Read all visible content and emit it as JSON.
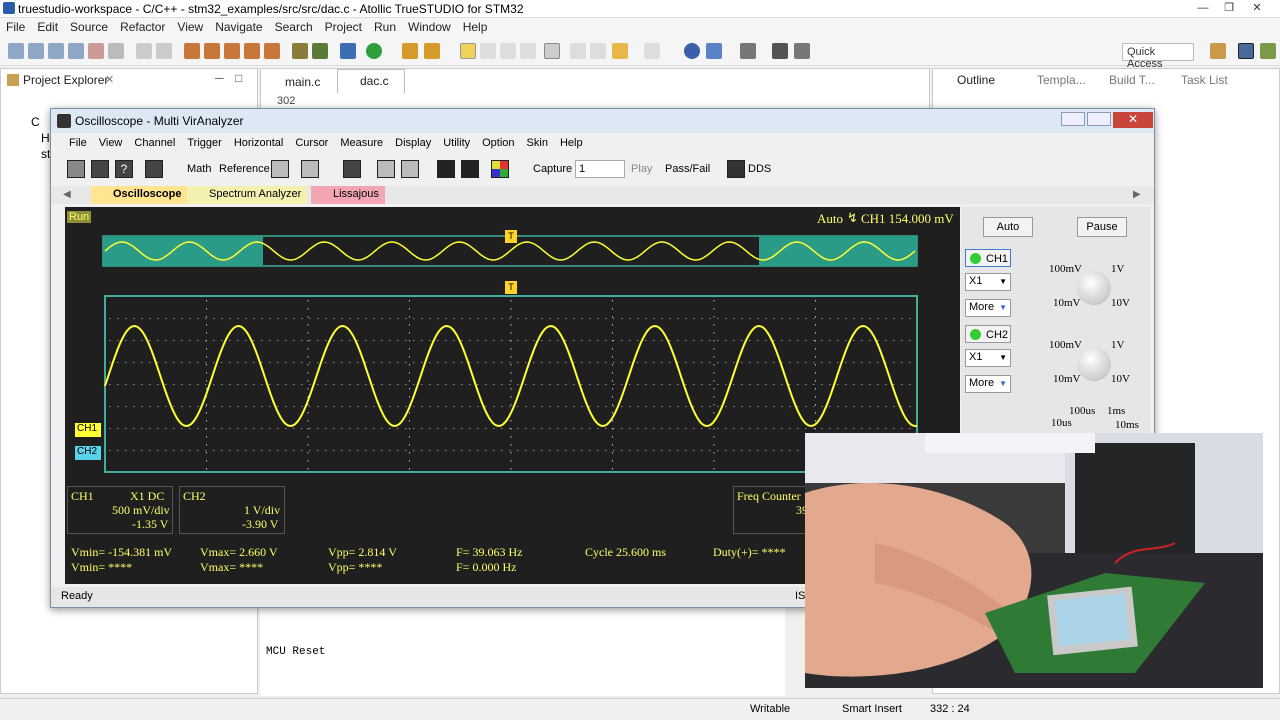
{
  "window": {
    "title": "truestudio-workspace - C/C++ - stm32_examples/src/src/dac.c - Atollic TrueSTUDIO for STM32"
  },
  "menu": [
    "File",
    "Edit",
    "Source",
    "Refactor",
    "View",
    "Navigate",
    "Search",
    "Project",
    "Run",
    "Window",
    "Help"
  ],
  "toolbar": {
    "quick_access": "Quick Access"
  },
  "project_explorer": {
    "title": "Project Explorer",
    "items": [
      "C",
      "H",
      "st"
    ]
  },
  "editor": {
    "tabs": [
      "main.c",
      "dac.c"
    ],
    "line": "302"
  },
  "right_views": {
    "tabs": [
      "Outline",
      "Templa...",
      "Build T...",
      "Task List"
    ]
  },
  "console": {
    "text": "MCU Reset"
  },
  "status_bar": {
    "writable": "Writable",
    "insert": "Smart Insert",
    "position": "332 : 24"
  },
  "osc": {
    "title": "Oscilloscope - Multi VirAnalyzer",
    "menu": [
      "File",
      "View",
      "Channel",
      "Trigger",
      "Horizontal",
      "Cursor",
      "Measure",
      "Display",
      "Utility",
      "Option",
      "Skin",
      "Help"
    ],
    "toolbar": {
      "math": "Math",
      "reference": "Reference",
      "capture": "Capture",
      "capture_value": "1",
      "play": "Play",
      "passfail": "Pass/Fail",
      "dds": "DDS"
    },
    "tabs": [
      "Oscilloscope",
      "Spectrum Analyzer",
      "Lissajous"
    ],
    "screen": {
      "run": "Run",
      "trigger_info": "Auto",
      "trigger_channel": "CH1 154.000 mV",
      "ch1_marker": "CH1",
      "ch2_marker": "CH2",
      "trigger_marker": "T"
    },
    "ch1_box": {
      "name": "CH1",
      "coupling": "X1  DC",
      "scale": "500 mV/div",
      "offset": "-1.35 V"
    },
    "ch2_box": {
      "name": "CH2",
      "scale": "1 V/div",
      "offset": "-3.90 V"
    },
    "freq_counter": {
      "label": "Freq Counter",
      "value": "39.0660"
    },
    "measurements": {
      "vmin1": "Vmin= -154.381 mV",
      "vmax1": "Vmax= 2.660 V",
      "vpp1": "Vpp= 2.814 V",
      "f1": "F= 39.063 Hz",
      "cycle": "Cycle 25.600 ms",
      "duty": "Duty(+)= ****",
      "vmin2": "Vmin= ****",
      "vmax2": "Vmax= ****",
      "vpp2": "Vpp= ****",
      "f2": "F= 0.000 Hz"
    },
    "side": {
      "auto": "Auto",
      "pause": "Pause",
      "ch1": "CH1",
      "ch2": "CH2",
      "probe1": "X1",
      "probe2": "X1",
      "more": "More",
      "k1": [
        "100mV",
        "1V",
        "10mV",
        "10V"
      ],
      "time": [
        "100us",
        "1ms",
        "10us",
        "10ms"
      ]
    },
    "status": "Ready",
    "status_right": "ISD"
  },
  "colors": {
    "trace": "#ffff33",
    "grid_border": "#3fae9a",
    "scope_bg": "#1f1f1f",
    "tab_osc": "#ffe58f",
    "tab_spec": "#f3f0b0",
    "tab_lis": "#f2a6b3"
  }
}
